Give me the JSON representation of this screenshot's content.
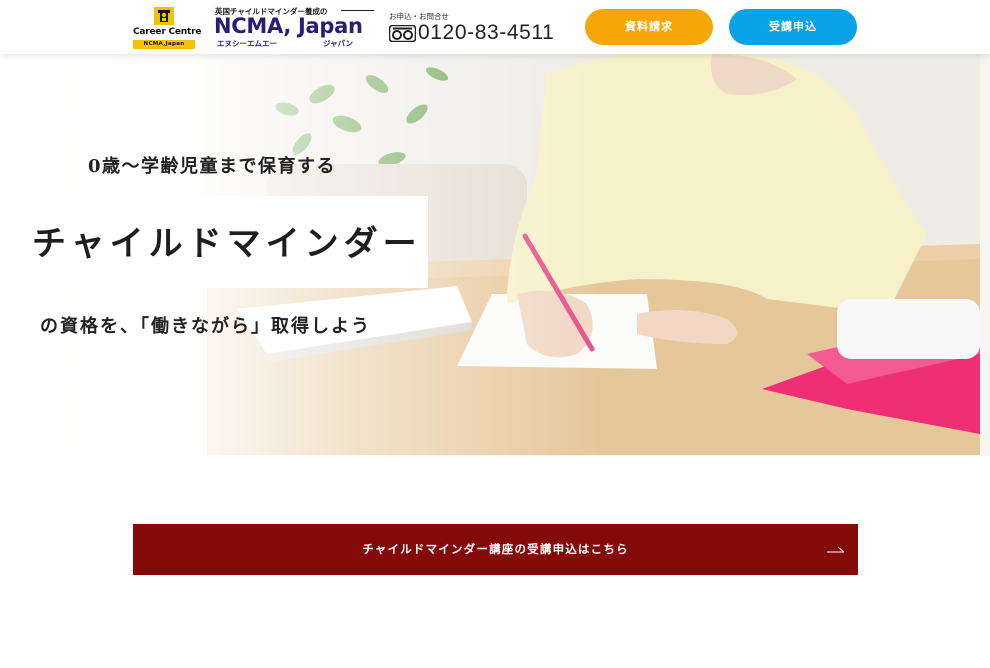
{
  "header": {
    "career_logo": {
      "line1": "Career Centre",
      "line2": "NCMA,Japan"
    },
    "ncma_logo": {
      "tagline": "英国チャイルドマインダー養成の",
      "brand": "NCMA, Japan",
      "ruby_left": "エヌシーエムエー",
      "ruby_right": "ジャパン"
    },
    "contact": {
      "label": "お申込・お問合せ",
      "phone": "0120-83-4511",
      "icon": "freedial-icon"
    },
    "buttons": {
      "brochure": "資料請求",
      "apply": "受講申込"
    }
  },
  "hero": {
    "subtitle": "0歳～学齢児童まで保育する",
    "title": "チャイルドマインダー",
    "lead": "の資格を、「働きながら」取得しよう"
  },
  "cta": {
    "label": "チャイルドマインダー講座の受講申込はこちら",
    "icon": "arrow-right-icon"
  },
  "colors": {
    "brand_navy": "#2b1c7a",
    "brochure_orange": "#f7a608",
    "apply_blue": "#0aa2e6",
    "cta_maroon": "#840a0a",
    "logo_yellow": "#f2c200"
  }
}
